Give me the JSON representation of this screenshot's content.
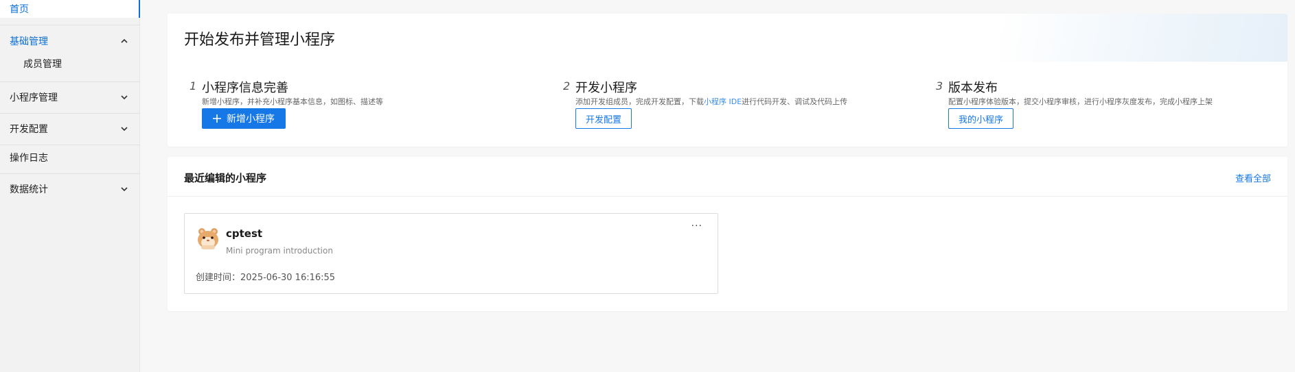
{
  "sidebar": {
    "home": "首页",
    "basic_management": "基础管理",
    "member_management": "成员管理",
    "mini_program_management": "小程序管理",
    "dev_config": "开发配置",
    "operation_log": "操作日志",
    "data_stats": "数据统计"
  },
  "header": {
    "title": "开始发布并管理小程序"
  },
  "steps": [
    {
      "num": "1",
      "title": "小程序信息完善",
      "desc": "新增小程序，并补充小程序基本信息，如图标、描述等",
      "button": "新增小程序"
    },
    {
      "num": "2",
      "title": "开发小程序",
      "desc_before": "添加开发组成员，完成开发配置，下载",
      "desc_link": "小程序 IDE",
      "desc_after": "进行代码开发、调试及代码上传",
      "button": "开发配置"
    },
    {
      "num": "3",
      "title": "版本发布",
      "desc": "配置小程序体验版本，提交小程序审核，进行小程序灰度发布，完成小程序上架",
      "button": "我的小程序"
    }
  ],
  "recent": {
    "title": "最近编辑的小程序",
    "view_all": "查看全部",
    "apps": [
      {
        "name": "cptest",
        "intro": "Mini program introduction",
        "created": "创建时间：2025-06-30 16:16:55",
        "more": "···"
      }
    ]
  },
  "colors": {
    "accent": "#1677e6",
    "link": "#3a8ee6",
    "sidebar_bg": "#f2f2f2",
    "page_bg": "#f7f7f7"
  }
}
